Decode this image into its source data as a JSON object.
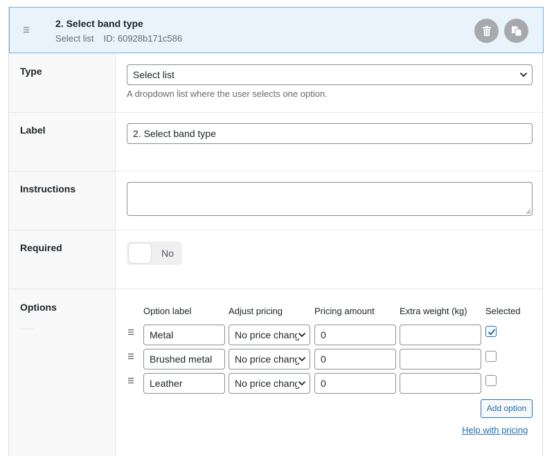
{
  "header": {
    "title": "2. Select band type",
    "field_type": "Select list",
    "id_text": "ID: 60928b171c586",
    "drag_icon": "drag-handle-icon",
    "delete_icon": "trash-icon",
    "duplicate_icon": "duplicate-icon"
  },
  "type_row": {
    "label": "Type",
    "value": "Select list",
    "help": "A dropdown list where the user selects one option."
  },
  "label_row": {
    "label": "Label",
    "value": "2. Select band type"
  },
  "instructions_row": {
    "label": "Instructions",
    "value": ""
  },
  "required_row": {
    "label": "Required",
    "toggle_state": "No",
    "enabled": false
  },
  "options_row": {
    "label": "Options",
    "columns": [
      "Option label",
      "Adjust pricing",
      "Pricing amount",
      "Extra weight (kg)",
      "Selected"
    ],
    "items": [
      {
        "label": "Metal",
        "pricing": "No price change",
        "amount": "0",
        "weight": "",
        "selected": true
      },
      {
        "label": "Brushed metal",
        "pricing": "No price change",
        "amount": "0",
        "weight": "",
        "selected": false
      },
      {
        "label": "Leather",
        "pricing": "No price change",
        "amount": "0",
        "weight": "",
        "selected": false
      }
    ],
    "add_button": "Add option",
    "help_link": "Help with pricing"
  },
  "colors": {
    "accent": "#2271b1",
    "header_bg": "#e9f3fc",
    "header_border": "#72aee6",
    "button_grey": "#a7aaad"
  }
}
